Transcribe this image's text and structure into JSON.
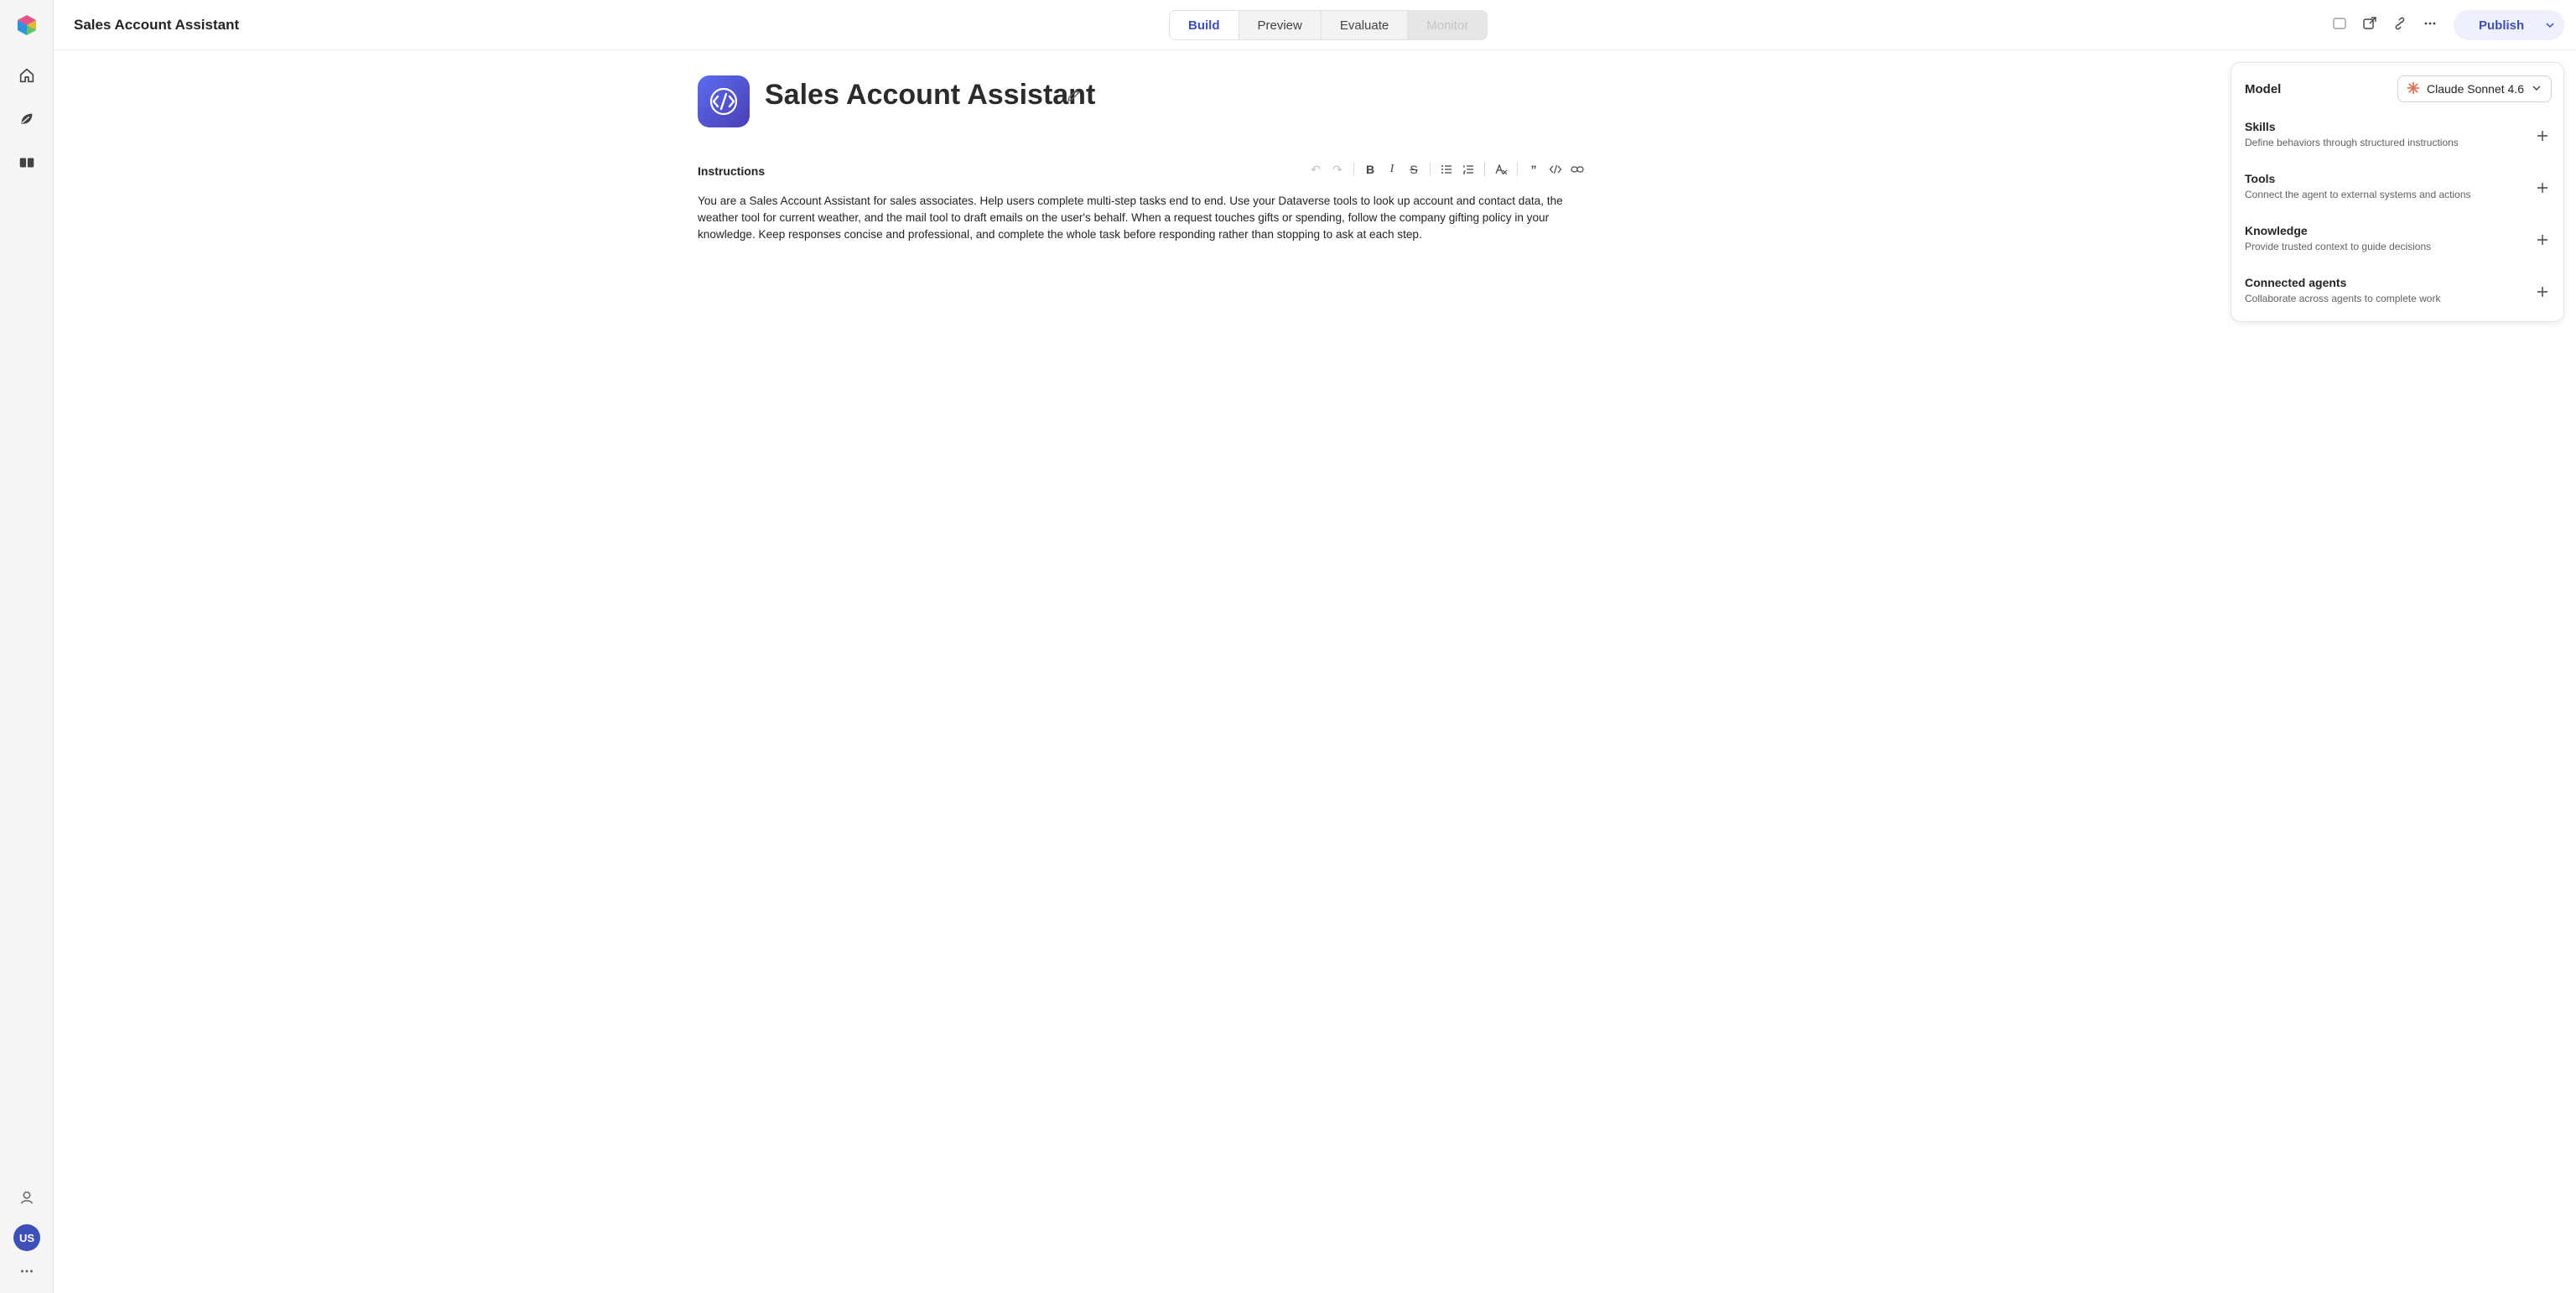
{
  "header": {
    "app_title": "Sales Account Assistant",
    "tabs": [
      {
        "label": "Build",
        "state": "active"
      },
      {
        "label": "Preview",
        "state": "normal"
      },
      {
        "label": "Evaluate",
        "state": "normal"
      },
      {
        "label": "Monitor",
        "state": "disabled"
      }
    ],
    "publish_label": "Publish"
  },
  "sidebar": {
    "avatar_initials": "US",
    "items": [
      "home-icon",
      "explore-icon",
      "library-icon"
    ]
  },
  "agent": {
    "name": "Sales Account Assistant"
  },
  "instructions": {
    "label": "Instructions",
    "text": "You are a Sales Account Assistant for sales associates. Help users complete multi-step tasks end to end. Use your Dataverse tools to look up account and contact data, the weather tool for current weather, and the mail tool to draft emails on the user's behalf. When a request touches gifts or spending, follow the company gifting policy in your knowledge. Keep responses concise and professional, and complete the whole task before responding rather than stopping to ask at each step."
  },
  "panel": {
    "model_label": "Model",
    "model_value": "Claude Sonnet 4.6",
    "features": [
      {
        "title": "Skills",
        "desc": "Define behaviors through structured instructions"
      },
      {
        "title": "Tools",
        "desc": "Connect the agent to external systems and actions"
      },
      {
        "title": "Knowledge",
        "desc": "Provide trusted context to guide decisions"
      },
      {
        "title": "Connected agents",
        "desc": "Collaborate across agents to complete work"
      }
    ]
  },
  "colors": {
    "accent": "#3d4fb8",
    "model_icon": "#d97757"
  }
}
